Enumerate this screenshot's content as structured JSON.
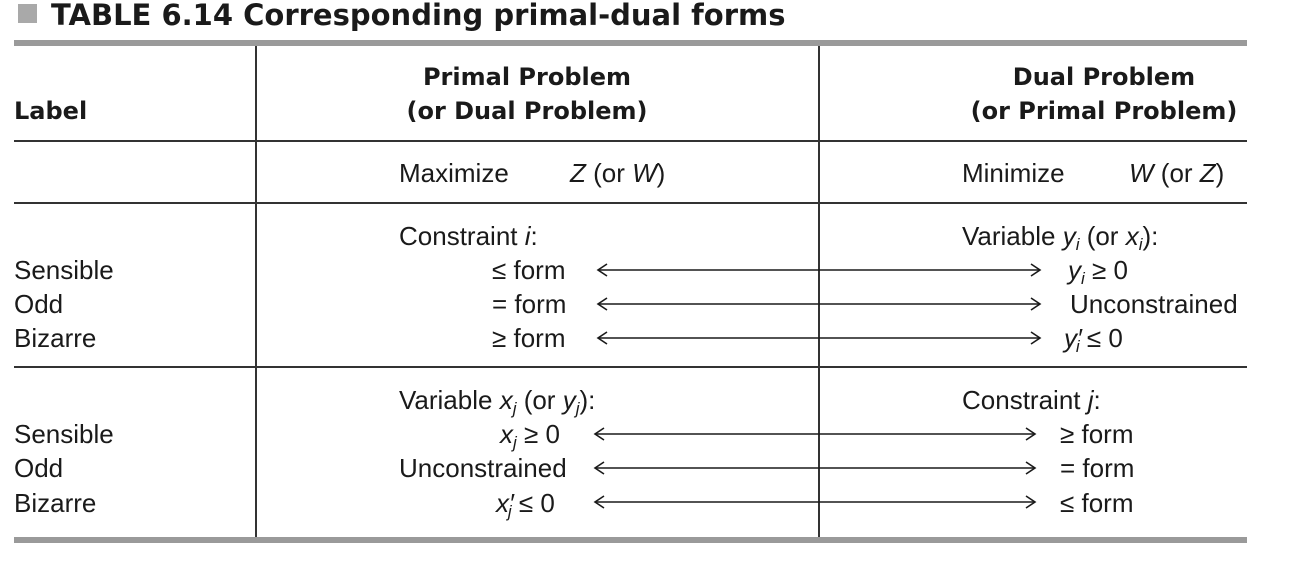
{
  "table": {
    "number": "TABLE 6.14",
    "title": "Corresponding primal-dual forms",
    "headers": {
      "label": "Label",
      "primal_line1": "Primal Problem",
      "primal_line2": "(or Dual Problem)",
      "dual_line1": "Dual Problem",
      "dual_line2": "(or Primal Problem)"
    },
    "objective": {
      "primal_verb": "Maximize",
      "primal_var": "Z",
      "primal_alt_open": "(or ",
      "primal_alt_var": "W",
      "primal_alt_close": ")",
      "dual_verb": "Minimize",
      "dual_var": "W",
      "dual_alt_open": "(or ",
      "dual_alt_var": "Z",
      "dual_alt_close": ")"
    },
    "section1": {
      "primal_heading_text": "Constraint ",
      "primal_heading_index": "i",
      "primal_heading_colon": ":",
      "dual_heading_text": "Variable ",
      "dual_heading_var": "y",
      "dual_heading_sub": "i",
      "dual_heading_alt_open": " (or ",
      "dual_heading_alt_var": "x",
      "dual_heading_alt_sub": "i",
      "dual_heading_alt_close": "):",
      "rows": [
        {
          "label": "Sensible",
          "primal": "≤ form",
          "dual_var": "y",
          "dual_sub": "i",
          "dual_rest": " ≥ 0"
        },
        {
          "label": "Odd",
          "primal": "= form",
          "dual_text": "Unconstrained"
        },
        {
          "label": "Bizarre",
          "primal": "≥ form",
          "dual_var": "y",
          "dual_prime": "′",
          "dual_sub": "i",
          "dual_rest": " ≤ 0"
        }
      ]
    },
    "section2": {
      "primal_heading_text": "Variable ",
      "primal_heading_var": "x",
      "primal_heading_sub": "j",
      "primal_heading_alt_open": " (or ",
      "primal_heading_alt_var": "y",
      "primal_heading_alt_sub": "j",
      "primal_heading_alt_close": "):",
      "dual_heading_text": "Constraint ",
      "dual_heading_index": "j",
      "dual_heading_colon": ":",
      "rows": [
        {
          "label": "Sensible",
          "primal_var": "x",
          "primal_sub": "j",
          "primal_rest": " ≥ 0",
          "dual": "≥ form"
        },
        {
          "label": "Odd",
          "primal_text": "Unconstrained",
          "dual": "= form"
        },
        {
          "label": "Bizarre",
          "primal_var": "x",
          "primal_prime": "′",
          "primal_sub": "j",
          "primal_rest": " ≤ 0",
          "dual": "≤ form"
        }
      ]
    }
  }
}
